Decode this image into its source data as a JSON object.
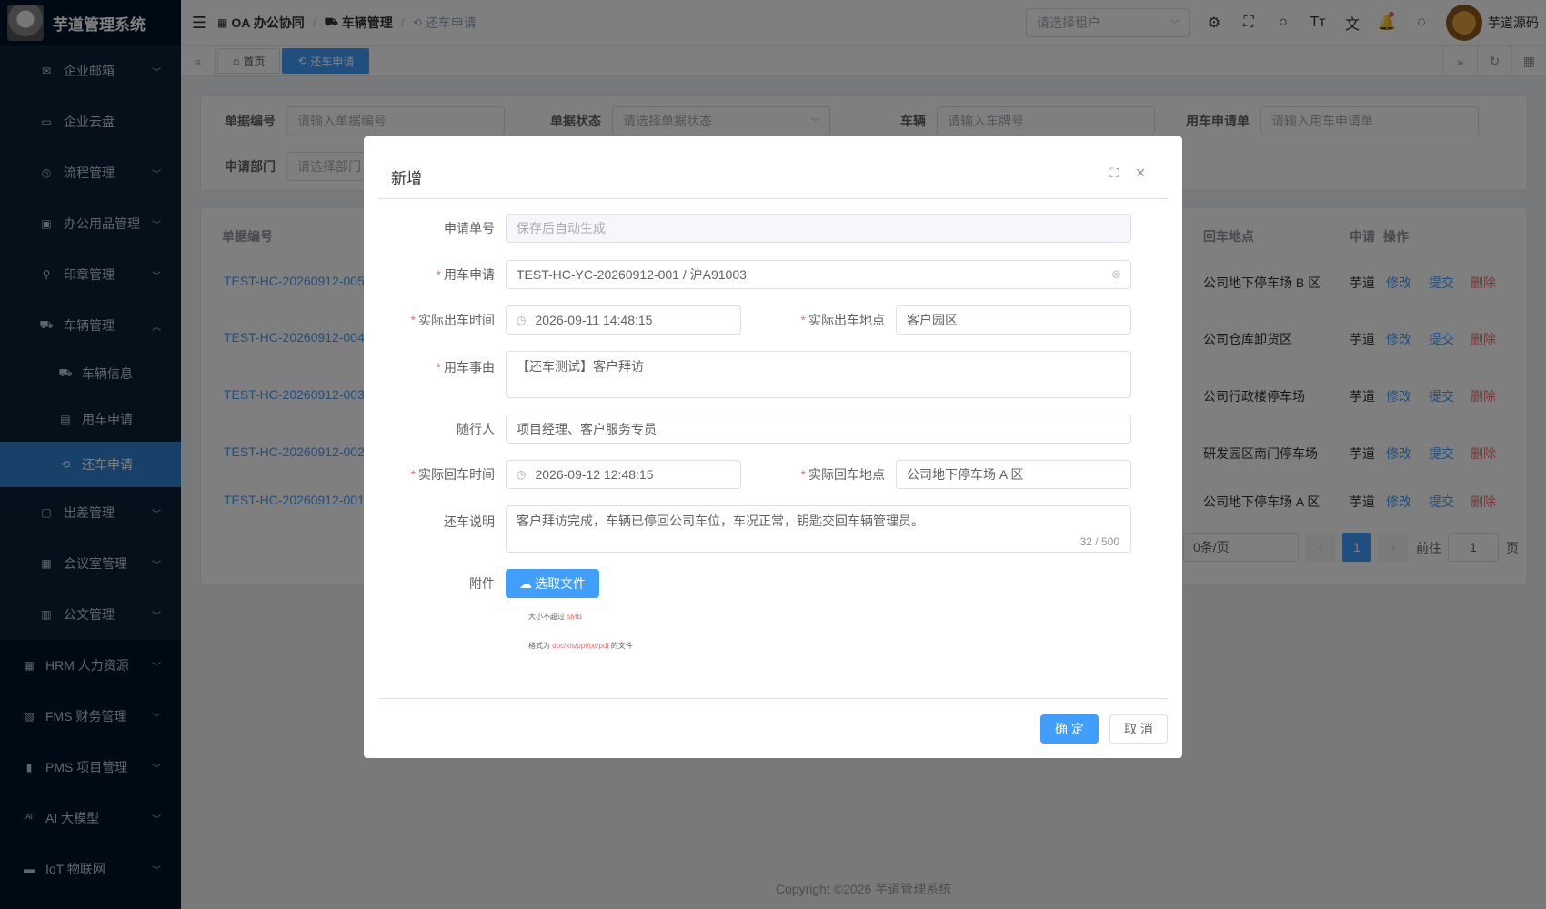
{
  "app": {
    "title": "芋道管理系统"
  },
  "sidebar": {
    "items": [
      {
        "label": "企业邮箱",
        "icon": "mail-icon",
        "arrow": "down"
      },
      {
        "label": "企业云盘",
        "icon": "folder-icon",
        "arrow": ""
      },
      {
        "label": "流程管理",
        "icon": "flow-icon",
        "arrow": "down"
      },
      {
        "label": "办公用品管理",
        "icon": "briefcase-icon",
        "arrow": "down"
      },
      {
        "label": "印章管理",
        "icon": "stamp-icon",
        "arrow": "down"
      },
      {
        "label": "车辆管理",
        "icon": "truck-icon",
        "arrow": "up"
      }
    ],
    "sub_items": [
      {
        "label": "车辆信息",
        "icon": "truck-icon"
      },
      {
        "label": "用车申请",
        "icon": "document-icon"
      },
      {
        "label": "还车申请",
        "icon": "return-icon"
      }
    ],
    "items2": [
      {
        "label": "出差管理",
        "icon": "suitcase-icon",
        "arrow": "down"
      },
      {
        "label": "会议室管理",
        "icon": "building-icon",
        "arrow": "down"
      },
      {
        "label": "公文管理",
        "icon": "files-icon",
        "arrow": "down"
      }
    ],
    "top_items": [
      {
        "label": "HRM 人力资源",
        "icon": "building-icon"
      },
      {
        "label": "FMS 财务管理",
        "icon": "finance-icon"
      },
      {
        "label": "PMS 项目管理",
        "icon": "chart-icon"
      },
      {
        "label": "AI 大模型",
        "icon": "ai-icon"
      },
      {
        "label": "IoT 物联网",
        "icon": "router-icon"
      }
    ]
  },
  "navbar": {
    "breadcrumb": [
      "OA 办公协同",
      "车辆管理",
      "还车申请"
    ],
    "tenant_placeholder": "请选择租户",
    "username": "芋道源码"
  },
  "tags": {
    "home": "首页",
    "current": "还车申请"
  },
  "search": {
    "fields": [
      {
        "label": "单据编号",
        "placeholder": "请输入单据编号"
      },
      {
        "label": "单据状态",
        "placeholder": "请选择单据状态"
      },
      {
        "label": "车辆",
        "placeholder": "请输入车牌号"
      },
      {
        "label": "用车申请单",
        "placeholder": "请输入用车申请单"
      },
      {
        "label": "申请部门",
        "placeholder": "请选择部门"
      }
    ]
  },
  "table": {
    "headers": {
      "code": "单据编号",
      "return_place": "回车地点",
      "applicant": "申请",
      "ops": "操作"
    },
    "rows": [
      {
        "code": "TEST-HC-20260912-005",
        "return_place": "公司地下停车场 B 区",
        "applicant": "芋道"
      },
      {
        "code": "TEST-HC-20260912-004",
        "return_place": "公司仓库卸货区",
        "applicant": "芋道"
      },
      {
        "code": "TEST-HC-20260912-003",
        "return_place": "公司行政楼停车场",
        "applicant": "芋道"
      },
      {
        "code": "TEST-HC-20260912-002",
        "return_place": "研发园区南门停车场",
        "applicant": "芋道"
      },
      {
        "code": "TEST-HC-20260912-001",
        "return_place": "公司地下停车场 A 区",
        "applicant": "芋道"
      }
    ],
    "op_labels": {
      "edit": "修改",
      "submit": "提交",
      "delete": "删除"
    }
  },
  "pagination": {
    "page_size": "0条/页",
    "current": "1",
    "goto_label": "前往",
    "goto_value": "1",
    "page_suffix": "页"
  },
  "footer": {
    "copyright": "Copyright ©2026 芋道管理系统"
  },
  "dialog": {
    "title": "新增",
    "fields": {
      "apply_no": {
        "label": "申请单号",
        "placeholder": "保存后自动生成"
      },
      "car_apply": {
        "label": "用车申请",
        "value": "TEST-HC-YC-20260912-001 / 沪A91003"
      },
      "out_time": {
        "label": "实际出车时间",
        "value": "2026-09-11 14:48:15"
      },
      "out_place": {
        "label": "实际出车地点",
        "value": "客户园区"
      },
      "reason": {
        "label": "用车事由",
        "value": "【还车测试】客户拜访"
      },
      "companion": {
        "label": "随行人",
        "value": "项目经理、客户服务专员"
      },
      "return_time": {
        "label": "实际回车时间",
        "value": "2026-09-12 12:48:15"
      },
      "return_place": {
        "label": "实际回车地点",
        "value": "公司地下停车场 A 区"
      },
      "note": {
        "label": "还车说明",
        "value": "客户拜访完成，车辆已停回公司车位，车况正常，钥匙交回车辆管理员。",
        "count": "32 / 500"
      },
      "attachment": {
        "label": "附件",
        "button": "选取文件"
      }
    },
    "tips": {
      "size_prefix": "大小不超过",
      "size_value": "5MB",
      "format_prefix": "格式为",
      "format_value": "doc/xls/ppt/txt/pdf",
      "format_suffix": "的文件"
    },
    "ok": "确 定",
    "cancel": "取 消"
  },
  "colors": {
    "primary": "#409eff",
    "danger": "#f56c6c",
    "sidebar": "#001529",
    "active": "#2f82d0"
  }
}
